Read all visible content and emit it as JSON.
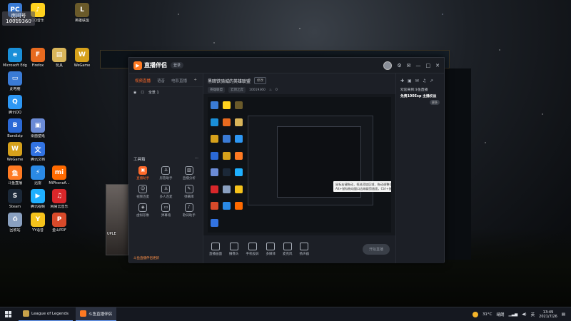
{
  "badge": {
    "line1": "房间号",
    "line2": "10019360"
  },
  "desktop_icons": [
    {
      "label": "此电脑",
      "color": "#3a7bd5",
      "glyph": "PC"
    },
    {
      "label": "QQ音乐",
      "color": "#ffd21e",
      "glyph": "♪"
    },
    {
      "label": "英雄联盟",
      "color": "#6a5a2a",
      "glyph": "L"
    },
    {
      "label": "Microsoft Edge",
      "color": "#1a8fd8",
      "glyph": "e"
    },
    {
      "label": "Firefox",
      "color": "#e86a1f",
      "glyph": "F"
    },
    {
      "label": "玩具",
      "color": "#d9b55a",
      "glyph": "▤"
    },
    {
      "label": "WeGame",
      "color": "#d6a11b",
      "glyph": "W"
    },
    {
      "label": "此电脑",
      "color": "#3a7bd5",
      "glyph": "▭"
    },
    {
      "label": "腾讯QQ",
      "color": "#2d97f4",
      "glyph": "Q"
    },
    {
      "label": "Bandizip",
      "color": "#2b69d6",
      "glyph": "B"
    },
    {
      "label": "WeGame",
      "color": "#d6a11b",
      "glyph": "W"
    },
    {
      "label": "斗鱼直播",
      "color": "#ff7a22",
      "glyph": "鱼"
    },
    {
      "label": "桌面壁纸",
      "color": "#6b8bd6",
      "glyph": "▣"
    },
    {
      "label": "Steam",
      "color": "#1b2838",
      "glyph": "S"
    },
    {
      "label": "腾讯视频",
      "color": "#1fb0ff",
      "glyph": "▶"
    },
    {
      "label": "网易云音乐",
      "color": "#d8272a",
      "glyph": "♫"
    },
    {
      "label": "回收站",
      "color": "#8aa0c0",
      "glyph": "♻"
    },
    {
      "label": "YY语音",
      "color": "#f5c21b",
      "glyph": "Y"
    },
    {
      "label": "金山PDF",
      "color": "#d84a2a",
      "glyph": "P"
    },
    {
      "label": "迅雷",
      "color": "#2a8ae6",
      "glyph": "⚡"
    },
    {
      "label": "MiPhoneA...",
      "color": "#ff6a00",
      "glyph": "mi"
    },
    {
      "label": "腾讯文档",
      "color": "#3273e2",
      "glyph": "文"
    }
  ],
  "app": {
    "brand": "直播伴侣",
    "login_button": "登录",
    "left_tabs": [
      {
        "label": "视频直播",
        "active": true
      },
      {
        "label": "语音",
        "active": false
      },
      {
        "label": "电影直播",
        "active": false
      }
    ],
    "scene_label": "全景 1",
    "tools_title": "工具箱",
    "tools": [
      {
        "label": "直播助手",
        "hot": true,
        "icon": "▣"
      },
      {
        "label": "房管助手",
        "hot": false,
        "icon": "♙"
      },
      {
        "label": "直播分析",
        "hot": false,
        "icon": "▥"
      },
      {
        "label": "视频连麦",
        "hot": false,
        "icon": "☺"
      },
      {
        "label": "多人连麦",
        "hot": false,
        "icon": "♙"
      },
      {
        "label": "弹幕库",
        "hot": false,
        "icon": "✎"
      },
      {
        "label": "虚拟形象",
        "hot": false,
        "icon": "◈"
      },
      {
        "label": "弹幕墙",
        "hot": false,
        "icon": "▭"
      },
      {
        "label": "歌词助手",
        "hot": false,
        "icon": "♪"
      }
    ],
    "notice": "斗鱼直播伴侣更新",
    "room": {
      "title": "黑暗铁骑城的英雄联盟",
      "tag": "修改",
      "category": "英雄联盟",
      "sub_category": "云顶之弈",
      "room_id_label": "10019360",
      "hot": "0"
    },
    "tip_text": "鼠标右键拖动，框选添加区域，拖动调整位置大小。按住Alt+鼠标拖动窗口边缘裁剪画面，Ctrl+鼠标滚轮缩放画面",
    "bottom_actions": [
      {
        "label": "直播画面",
        "name": "live-screen-button"
      },
      {
        "label": "摄像头",
        "name": "camera-button"
      },
      {
        "label": "手机投屏",
        "name": "phone-cast-button"
      },
      {
        "label": "多媒体",
        "name": "media-button"
      },
      {
        "label": "麦克风",
        "name": "mic-button"
      },
      {
        "label": "扬声器",
        "name": "speaker-button"
      }
    ],
    "start_live": "开始直播",
    "right_panel": {
      "line1": "欢迎来到斗鱼直播",
      "line2": "免费100Exp 主播权益",
      "more": "更多"
    }
  },
  "camera": {
    "label": "UPLE"
  },
  "taskbar": {
    "items": [
      {
        "label": "League of Legends",
        "color": "#c8a24a",
        "active": false
      },
      {
        "label": "斗鱼直播伴侣",
        "color": "#ff7a22",
        "active": true
      }
    ],
    "temperature": "31°C",
    "weather": "晴朗",
    "ime": "英",
    "time": "13:49",
    "date": "2021/7/26"
  }
}
